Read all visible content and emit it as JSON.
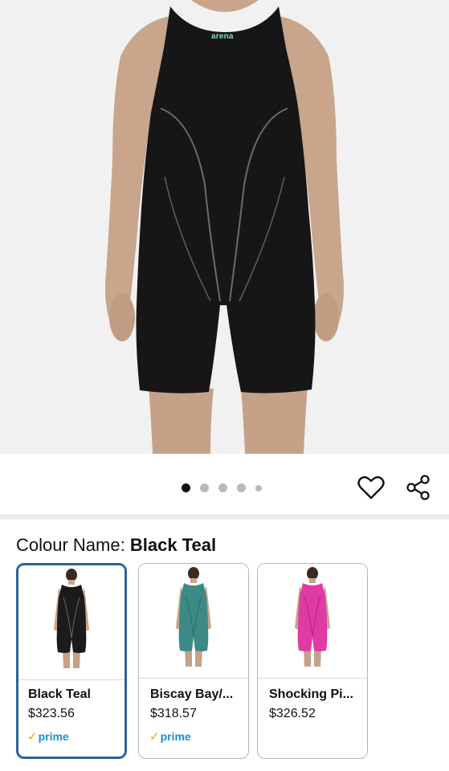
{
  "hero": {
    "brand_text": "arena",
    "carousel_dots": 5,
    "active_dot": 0,
    "background": "#f1f1f1"
  },
  "actions": {
    "favorite_icon": "heart-icon",
    "share_icon": "share-icon"
  },
  "colour": {
    "label": "Colour Name: ",
    "value": "Black Teal"
  },
  "swatches": [
    {
      "name": "Black Teal",
      "price": "$323.56",
      "prime": "prime",
      "has_prime": true,
      "selected": true,
      "suit_color": "#1b1b1b"
    },
    {
      "name": "Biscay Bay/...",
      "price": "$318.57",
      "prime": "prime",
      "has_prime": true,
      "selected": false,
      "suit_color": "#3c8a86"
    },
    {
      "name": "Shocking Pi...",
      "price": "$326.52",
      "prime": "",
      "has_prime": false,
      "selected": false,
      "suit_color": "#e03aa4"
    }
  ],
  "colors": {
    "selected_border": "#2a6496",
    "prime_blue": "#1f8ed6",
    "prime_check": "#f7a200"
  }
}
